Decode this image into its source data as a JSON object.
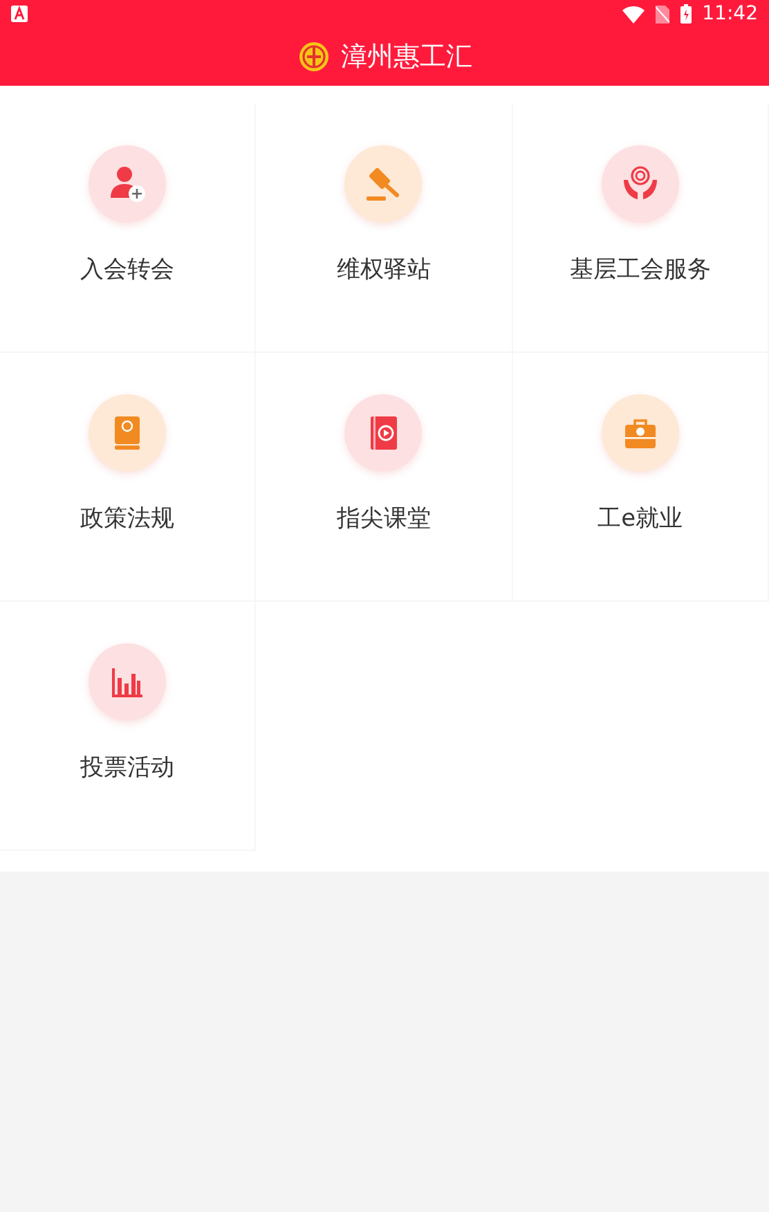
{
  "status_bar": {
    "time": "11:42"
  },
  "header": {
    "title": "漳州惠工汇"
  },
  "services": [
    {
      "label": "入会转会"
    },
    {
      "label": "维权驿站"
    },
    {
      "label": "基层工会服务"
    },
    {
      "label": "政策法规"
    },
    {
      "label": "指尖课堂"
    },
    {
      "label": "工e就业"
    },
    {
      "label": "投票活动"
    }
  ]
}
